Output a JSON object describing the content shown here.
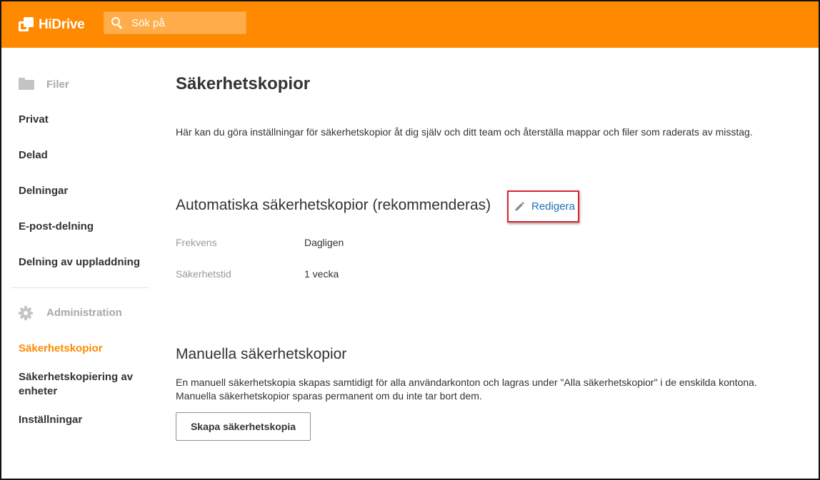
{
  "header": {
    "logo_text": "HiDrive",
    "search_placeholder": "Sök på"
  },
  "sidebar": {
    "files_group": "Filer",
    "files_items": [
      "Privat",
      "Delad",
      "Delningar",
      "E-post-delning",
      "Delning av uppladdning"
    ],
    "admin_group": "Administration",
    "admin_items": [
      "Säkerhetskopior",
      "Säkerhetskopiering av enheter",
      "Inställningar"
    ],
    "active_item": "Säkerhetskopior"
  },
  "main": {
    "title": "Säkerhetskopior",
    "intro": "Här kan du göra inställningar för säkerhetskopior åt dig själv och ditt team och återställa mappar och filer som raderats av misstag.",
    "auto": {
      "title": "Automatiska säkerhetskopior (rekommenderas)",
      "edit_label": "Redigera",
      "frequency_label": "Frekvens",
      "frequency_value": "Dagligen",
      "retention_label": "Säkerhetstid",
      "retention_value": "1 vecka"
    },
    "manual": {
      "title": "Manuella säkerhetskopior",
      "description_line1": "En manuell säkerhetskopia skapas samtidigt för alla användarkonton och lagras under \"Alla säkerhetskopior\" i de enskilda kontona.",
      "description_line2": "Manuella säkerhetskopior sparas permanent om du inte tar bort dem.",
      "button_label": "Skapa säkerhetskopia"
    }
  },
  "colors": {
    "brand_orange": "#ff8a00",
    "link_blue": "#1f6fb5",
    "highlight_red": "#d9232e"
  },
  "icons": [
    "hidrive-logo-icon",
    "search-icon",
    "folder-icon",
    "gear-icon",
    "pencil-icon"
  ]
}
